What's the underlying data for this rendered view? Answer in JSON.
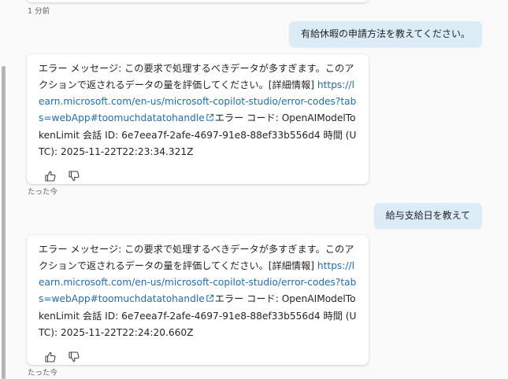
{
  "messages": {
    "prev_timestamp": "1 分前",
    "user1": "有給休暇の申請方法を教えてください。",
    "bot1": {
      "text_a": "エラー メッセージ: この要求で処理するべきデータが多すぎます。このアクションで返されるデータの量を評価してください。[詳細情報]",
      "link": "https://learn.microsoft.com/en-us/microsoft-copilot-studio/error-codes?tabs=webApp#toomuchdatatohandle",
      "text_b": "エラー コード: OpenAIModelTokenLimit 会話 ID: 6e7eea7f-2afe-4697-91e8-88ef33b556d4 時間 (UTC): 2025-11-22T22:23:34.321Z",
      "timestamp": "たった今"
    },
    "user2": "給与支給日を教えて",
    "bot2": {
      "text_a": "エラー メッセージ: この要求で処理するべきデータが多すぎます。このアクションで返されるデータの量を評価してください。[詳細情報]",
      "link": "https://learn.microsoft.com/en-us/microsoft-copilot-studio/error-codes?tabs=webApp#toomuchdatatohandle",
      "text_b": "エラー コード: OpenAIModelTokenLimit 会話 ID: 6e7eea7f-2afe-4697-91e8-88ef33b556d4 時間 (UTC): 2025-11-22T22:24:20.660Z",
      "timestamp": "たった今"
    }
  },
  "icons": {
    "thumbs_up": "thumbs-up-icon",
    "thumbs_down": "thumbs-down-icon",
    "external_link": "external-link-icon"
  },
  "colors": {
    "user_bubble": "#dbecf7",
    "link": "#1f6db5",
    "background": "#fafafa"
  }
}
